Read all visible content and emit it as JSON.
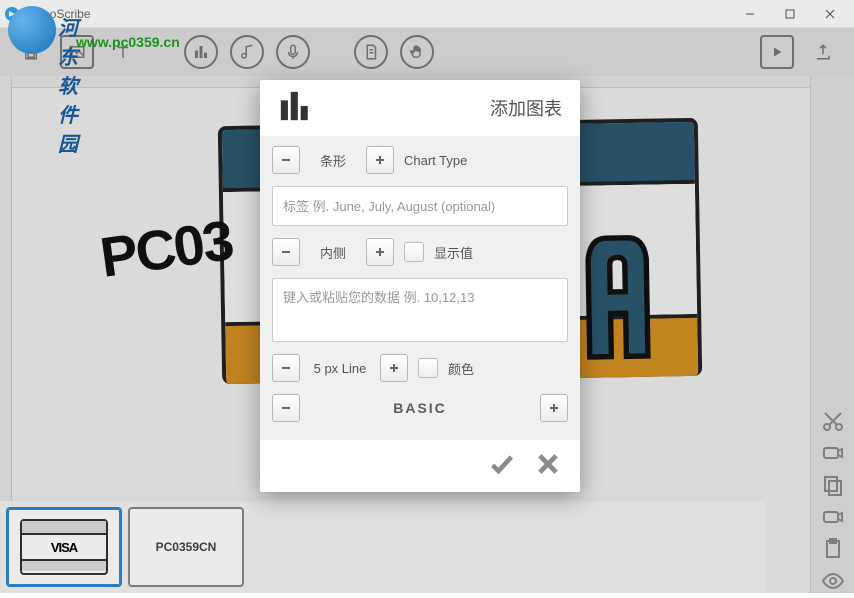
{
  "window": {
    "title": "VideoScribe"
  },
  "watermark": {
    "line1": "河东软件园",
    "line2": "www.pc0359.cn"
  },
  "canvas": {
    "big_text": "PC03",
    "letter": "A"
  },
  "timeline": {
    "thumb1_label": "VISA",
    "thumb2_label": "PC0359CN"
  },
  "dialog": {
    "title": "添加图表",
    "chart_type_value": "条形",
    "chart_type_label": "Chart Type",
    "labels_placeholder": "标签 例. June, July, August (optional)",
    "values_position": "内侧",
    "show_values_label": "显示值",
    "data_placeholder": "键入或粘贴您的数据 例. 10,12,13",
    "line_label": "5 px Line",
    "color_label": "颜色",
    "style_label": "BASIC"
  }
}
